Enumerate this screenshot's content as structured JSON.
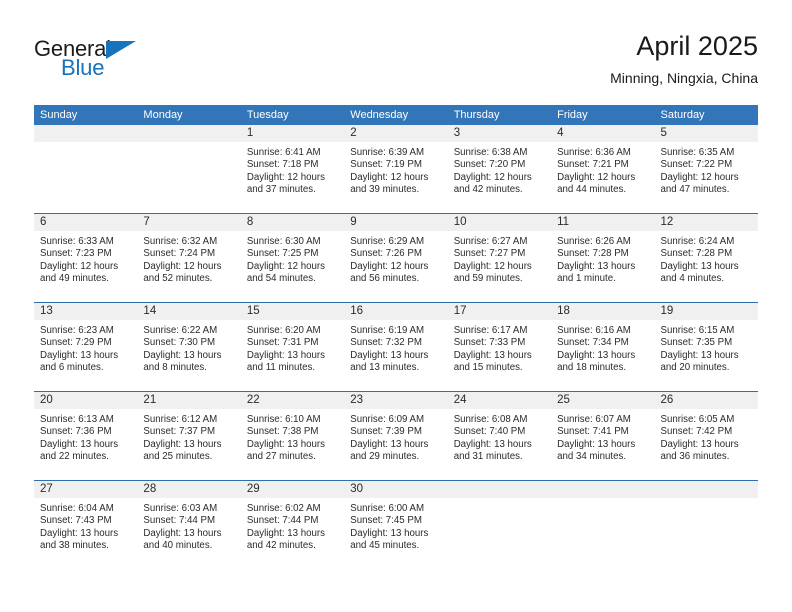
{
  "brand": {
    "name_part1": "General",
    "name_part2": "Blue",
    "accent_color": "#1673bd"
  },
  "header": {
    "title": "April 2025",
    "subtitle": "Minning, Ningxia, China"
  },
  "theme": {
    "header_blue": "#3275b8",
    "row_divider_blue": "#2f6fad",
    "daynum_band": "#f0f0f0"
  },
  "weekdays": [
    "Sunday",
    "Monday",
    "Tuesday",
    "Wednesday",
    "Thursday",
    "Friday",
    "Saturday"
  ],
  "weeks": [
    [
      {
        "day": "",
        "sunrise": "",
        "sunset": "",
        "daylight_1": "",
        "daylight_2": ""
      },
      {
        "day": "",
        "sunrise": "",
        "sunset": "",
        "daylight_1": "",
        "daylight_2": ""
      },
      {
        "day": "1",
        "sunrise": "Sunrise: 6:41 AM",
        "sunset": "Sunset: 7:18 PM",
        "daylight_1": "Daylight: 12 hours",
        "daylight_2": "and 37 minutes."
      },
      {
        "day": "2",
        "sunrise": "Sunrise: 6:39 AM",
        "sunset": "Sunset: 7:19 PM",
        "daylight_1": "Daylight: 12 hours",
        "daylight_2": "and 39 minutes."
      },
      {
        "day": "3",
        "sunrise": "Sunrise: 6:38 AM",
        "sunset": "Sunset: 7:20 PM",
        "daylight_1": "Daylight: 12 hours",
        "daylight_2": "and 42 minutes."
      },
      {
        "day": "4",
        "sunrise": "Sunrise: 6:36 AM",
        "sunset": "Sunset: 7:21 PM",
        "daylight_1": "Daylight: 12 hours",
        "daylight_2": "and 44 minutes."
      },
      {
        "day": "5",
        "sunrise": "Sunrise: 6:35 AM",
        "sunset": "Sunset: 7:22 PM",
        "daylight_1": "Daylight: 12 hours",
        "daylight_2": "and 47 minutes."
      }
    ],
    [
      {
        "day": "6",
        "sunrise": "Sunrise: 6:33 AM",
        "sunset": "Sunset: 7:23 PM",
        "daylight_1": "Daylight: 12 hours",
        "daylight_2": "and 49 minutes."
      },
      {
        "day": "7",
        "sunrise": "Sunrise: 6:32 AM",
        "sunset": "Sunset: 7:24 PM",
        "daylight_1": "Daylight: 12 hours",
        "daylight_2": "and 52 minutes."
      },
      {
        "day": "8",
        "sunrise": "Sunrise: 6:30 AM",
        "sunset": "Sunset: 7:25 PM",
        "daylight_1": "Daylight: 12 hours",
        "daylight_2": "and 54 minutes."
      },
      {
        "day": "9",
        "sunrise": "Sunrise: 6:29 AM",
        "sunset": "Sunset: 7:26 PM",
        "daylight_1": "Daylight: 12 hours",
        "daylight_2": "and 56 minutes."
      },
      {
        "day": "10",
        "sunrise": "Sunrise: 6:27 AM",
        "sunset": "Sunset: 7:27 PM",
        "daylight_1": "Daylight: 12 hours",
        "daylight_2": "and 59 minutes."
      },
      {
        "day": "11",
        "sunrise": "Sunrise: 6:26 AM",
        "sunset": "Sunset: 7:28 PM",
        "daylight_1": "Daylight: 13 hours",
        "daylight_2": "and 1 minute."
      },
      {
        "day": "12",
        "sunrise": "Sunrise: 6:24 AM",
        "sunset": "Sunset: 7:28 PM",
        "daylight_1": "Daylight: 13 hours",
        "daylight_2": "and 4 minutes."
      }
    ],
    [
      {
        "day": "13",
        "sunrise": "Sunrise: 6:23 AM",
        "sunset": "Sunset: 7:29 PM",
        "daylight_1": "Daylight: 13 hours",
        "daylight_2": "and 6 minutes."
      },
      {
        "day": "14",
        "sunrise": "Sunrise: 6:22 AM",
        "sunset": "Sunset: 7:30 PM",
        "daylight_1": "Daylight: 13 hours",
        "daylight_2": "and 8 minutes."
      },
      {
        "day": "15",
        "sunrise": "Sunrise: 6:20 AM",
        "sunset": "Sunset: 7:31 PM",
        "daylight_1": "Daylight: 13 hours",
        "daylight_2": "and 11 minutes."
      },
      {
        "day": "16",
        "sunrise": "Sunrise: 6:19 AM",
        "sunset": "Sunset: 7:32 PM",
        "daylight_1": "Daylight: 13 hours",
        "daylight_2": "and 13 minutes."
      },
      {
        "day": "17",
        "sunrise": "Sunrise: 6:17 AM",
        "sunset": "Sunset: 7:33 PM",
        "daylight_1": "Daylight: 13 hours",
        "daylight_2": "and 15 minutes."
      },
      {
        "day": "18",
        "sunrise": "Sunrise: 6:16 AM",
        "sunset": "Sunset: 7:34 PM",
        "daylight_1": "Daylight: 13 hours",
        "daylight_2": "and 18 minutes."
      },
      {
        "day": "19",
        "sunrise": "Sunrise: 6:15 AM",
        "sunset": "Sunset: 7:35 PM",
        "daylight_1": "Daylight: 13 hours",
        "daylight_2": "and 20 minutes."
      }
    ],
    [
      {
        "day": "20",
        "sunrise": "Sunrise: 6:13 AM",
        "sunset": "Sunset: 7:36 PM",
        "daylight_1": "Daylight: 13 hours",
        "daylight_2": "and 22 minutes."
      },
      {
        "day": "21",
        "sunrise": "Sunrise: 6:12 AM",
        "sunset": "Sunset: 7:37 PM",
        "daylight_1": "Daylight: 13 hours",
        "daylight_2": "and 25 minutes."
      },
      {
        "day": "22",
        "sunrise": "Sunrise: 6:10 AM",
        "sunset": "Sunset: 7:38 PM",
        "daylight_1": "Daylight: 13 hours",
        "daylight_2": "and 27 minutes."
      },
      {
        "day": "23",
        "sunrise": "Sunrise: 6:09 AM",
        "sunset": "Sunset: 7:39 PM",
        "daylight_1": "Daylight: 13 hours",
        "daylight_2": "and 29 minutes."
      },
      {
        "day": "24",
        "sunrise": "Sunrise: 6:08 AM",
        "sunset": "Sunset: 7:40 PM",
        "daylight_1": "Daylight: 13 hours",
        "daylight_2": "and 31 minutes."
      },
      {
        "day": "25",
        "sunrise": "Sunrise: 6:07 AM",
        "sunset": "Sunset: 7:41 PM",
        "daylight_1": "Daylight: 13 hours",
        "daylight_2": "and 34 minutes."
      },
      {
        "day": "26",
        "sunrise": "Sunrise: 6:05 AM",
        "sunset": "Sunset: 7:42 PM",
        "daylight_1": "Daylight: 13 hours",
        "daylight_2": "and 36 minutes."
      }
    ],
    [
      {
        "day": "27",
        "sunrise": "Sunrise: 6:04 AM",
        "sunset": "Sunset: 7:43 PM",
        "daylight_1": "Daylight: 13 hours",
        "daylight_2": "and 38 minutes."
      },
      {
        "day": "28",
        "sunrise": "Sunrise: 6:03 AM",
        "sunset": "Sunset: 7:44 PM",
        "daylight_1": "Daylight: 13 hours",
        "daylight_2": "and 40 minutes."
      },
      {
        "day": "29",
        "sunrise": "Sunrise: 6:02 AM",
        "sunset": "Sunset: 7:44 PM",
        "daylight_1": "Daylight: 13 hours",
        "daylight_2": "and 42 minutes."
      },
      {
        "day": "30",
        "sunrise": "Sunrise: 6:00 AM",
        "sunset": "Sunset: 7:45 PM",
        "daylight_1": "Daylight: 13 hours",
        "daylight_2": "and 45 minutes."
      },
      {
        "day": "",
        "sunrise": "",
        "sunset": "",
        "daylight_1": "",
        "daylight_2": ""
      },
      {
        "day": "",
        "sunrise": "",
        "sunset": "",
        "daylight_1": "",
        "daylight_2": ""
      },
      {
        "day": "",
        "sunrise": "",
        "sunset": "",
        "daylight_1": "",
        "daylight_2": ""
      }
    ]
  ]
}
